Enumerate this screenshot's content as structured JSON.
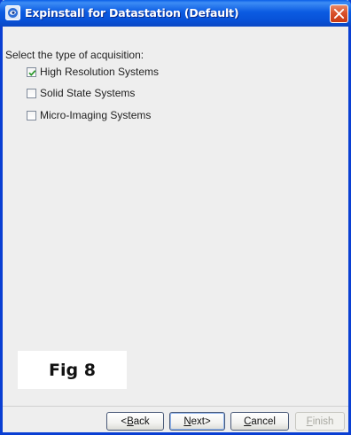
{
  "window": {
    "title": "Expinstall for Datastation (Default)",
    "title_color": "#0a5fe8",
    "close_icon": "close-icon"
  },
  "content": {
    "prompt": "Select the type of acquisition:",
    "options": [
      {
        "label": "High Resolution Systems",
        "checked": true
      },
      {
        "label": "Solid State Systems",
        "checked": false
      },
      {
        "label": "Micro-Imaging Systems",
        "checked": false
      }
    ],
    "figure_label": "Fig 8"
  },
  "footer": {
    "back": {
      "mnemonic": "B",
      "rest": "ack",
      "prefix": "< "
    },
    "next": {
      "mnemonic": "N",
      "rest": "ext",
      "suffix": " >"
    },
    "cancel": {
      "mnemonic": "C",
      "rest": "ancel"
    },
    "finish": {
      "mnemonic": "F",
      "rest": "inish",
      "enabled": false
    }
  }
}
